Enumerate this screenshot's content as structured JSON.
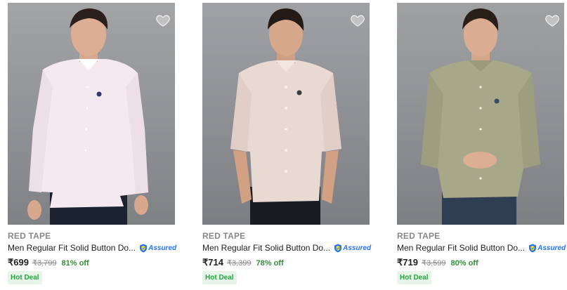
{
  "products": [
    {
      "brand": "RED TAPE",
      "title": "Men Regular Fit Solid Button Do...",
      "assured": "Assured",
      "price": "₹699",
      "mrp": "₹3,799",
      "discount": "81% off",
      "deal": "Hot Deal",
      "shirt_color": "#f3e9ee",
      "image_alt": "man wearing light pink shirt"
    },
    {
      "brand": "RED TAPE",
      "title": "Men Regular Fit Solid Button Do...",
      "assured": "Assured",
      "price": "₹714",
      "mrp": "₹3,399",
      "discount": "78% off",
      "deal": "Hot Deal",
      "shirt_color": "#e9d9d3",
      "image_alt": "man wearing beige pink shirt"
    },
    {
      "brand": "RED TAPE",
      "title": "Men Regular Fit Solid Button Do...",
      "assured": "Assured",
      "price": "₹719",
      "mrp": "₹3,599",
      "discount": "80% off",
      "deal": "Hot Deal",
      "shirt_color": "#a7a78a",
      "image_alt": "man wearing olive shirt"
    }
  ],
  "icons": {
    "wishlist": "heart-icon",
    "assured": "shield-icon"
  },
  "colors": {
    "accent_blue": "#2874f0",
    "discount_green": "#388e3c",
    "deal_green": "#26a541"
  }
}
